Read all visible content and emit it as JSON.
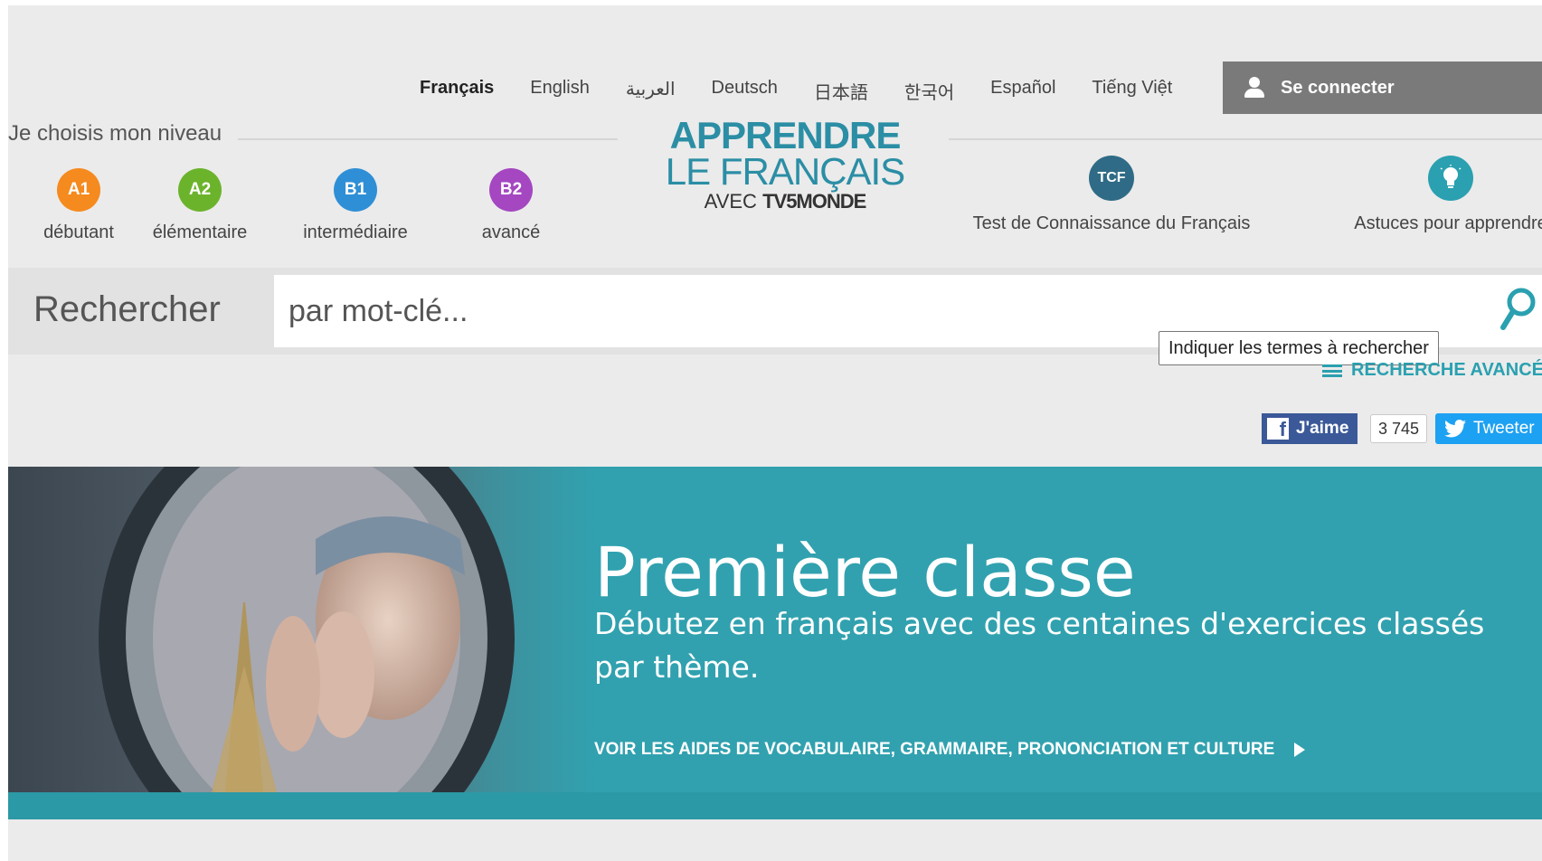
{
  "languages": [
    {
      "label": "Français",
      "active": true
    },
    {
      "label": "English",
      "active": false
    },
    {
      "label": "العربية",
      "active": false
    },
    {
      "label": "Deutsch",
      "active": false
    },
    {
      "label": "日本語",
      "active": false
    },
    {
      "label": "한국어",
      "active": false
    },
    {
      "label": "Español",
      "active": false
    },
    {
      "label": "Tiếng Việt",
      "active": false
    }
  ],
  "login": {
    "label": "Se connecter",
    "icon": "user-icon"
  },
  "niveau": {
    "title": "Je choisis mon niveau",
    "levels": [
      {
        "code": "A1",
        "label": "débutant",
        "color": "#f58a1f"
      },
      {
        "code": "A2",
        "label": "élémentaire",
        "color": "#6cb32c"
      },
      {
        "code": "B1",
        "label": "intermédiaire",
        "color": "#2f8fd6"
      },
      {
        "code": "B2",
        "label": "avancé",
        "color": "#a447c1"
      }
    ]
  },
  "logo": {
    "line1": "APPRENDRE",
    "line2": "LE FRANÇAIS",
    "line3_prefix": "AVEC",
    "line3_brand": "TV5MONDE",
    "color": "#2b8ea5"
  },
  "tcf": {
    "badge": "TCF",
    "label": "Test de Connaissance du Français",
    "color": "#2f6b86"
  },
  "astuces": {
    "label": "Astuces pour apprendre",
    "icon": "lightbulb-icon",
    "color": "#2aa0b0"
  },
  "search": {
    "label": "Rechercher",
    "placeholder": "par mot-clé...",
    "icon": "search-icon",
    "tooltip": "Indiquer les termes à rechercher"
  },
  "advanced_search": {
    "label": "RECHERCHE AVANCÉE",
    "icon": "menu-icon"
  },
  "social": {
    "facebook_label": "J'aime",
    "facebook_count": "3 745",
    "twitter_label": "Tweeter"
  },
  "hero": {
    "title": "Première classe",
    "subtitle": "Débutez en français avec des centaines d'exercices classés par thème.",
    "link": "VOIR LES AIDES DE VOCABULAIRE, GRAMMAIRE, PRONONCIATION ET CULTURE",
    "background": "#31a1af"
  }
}
